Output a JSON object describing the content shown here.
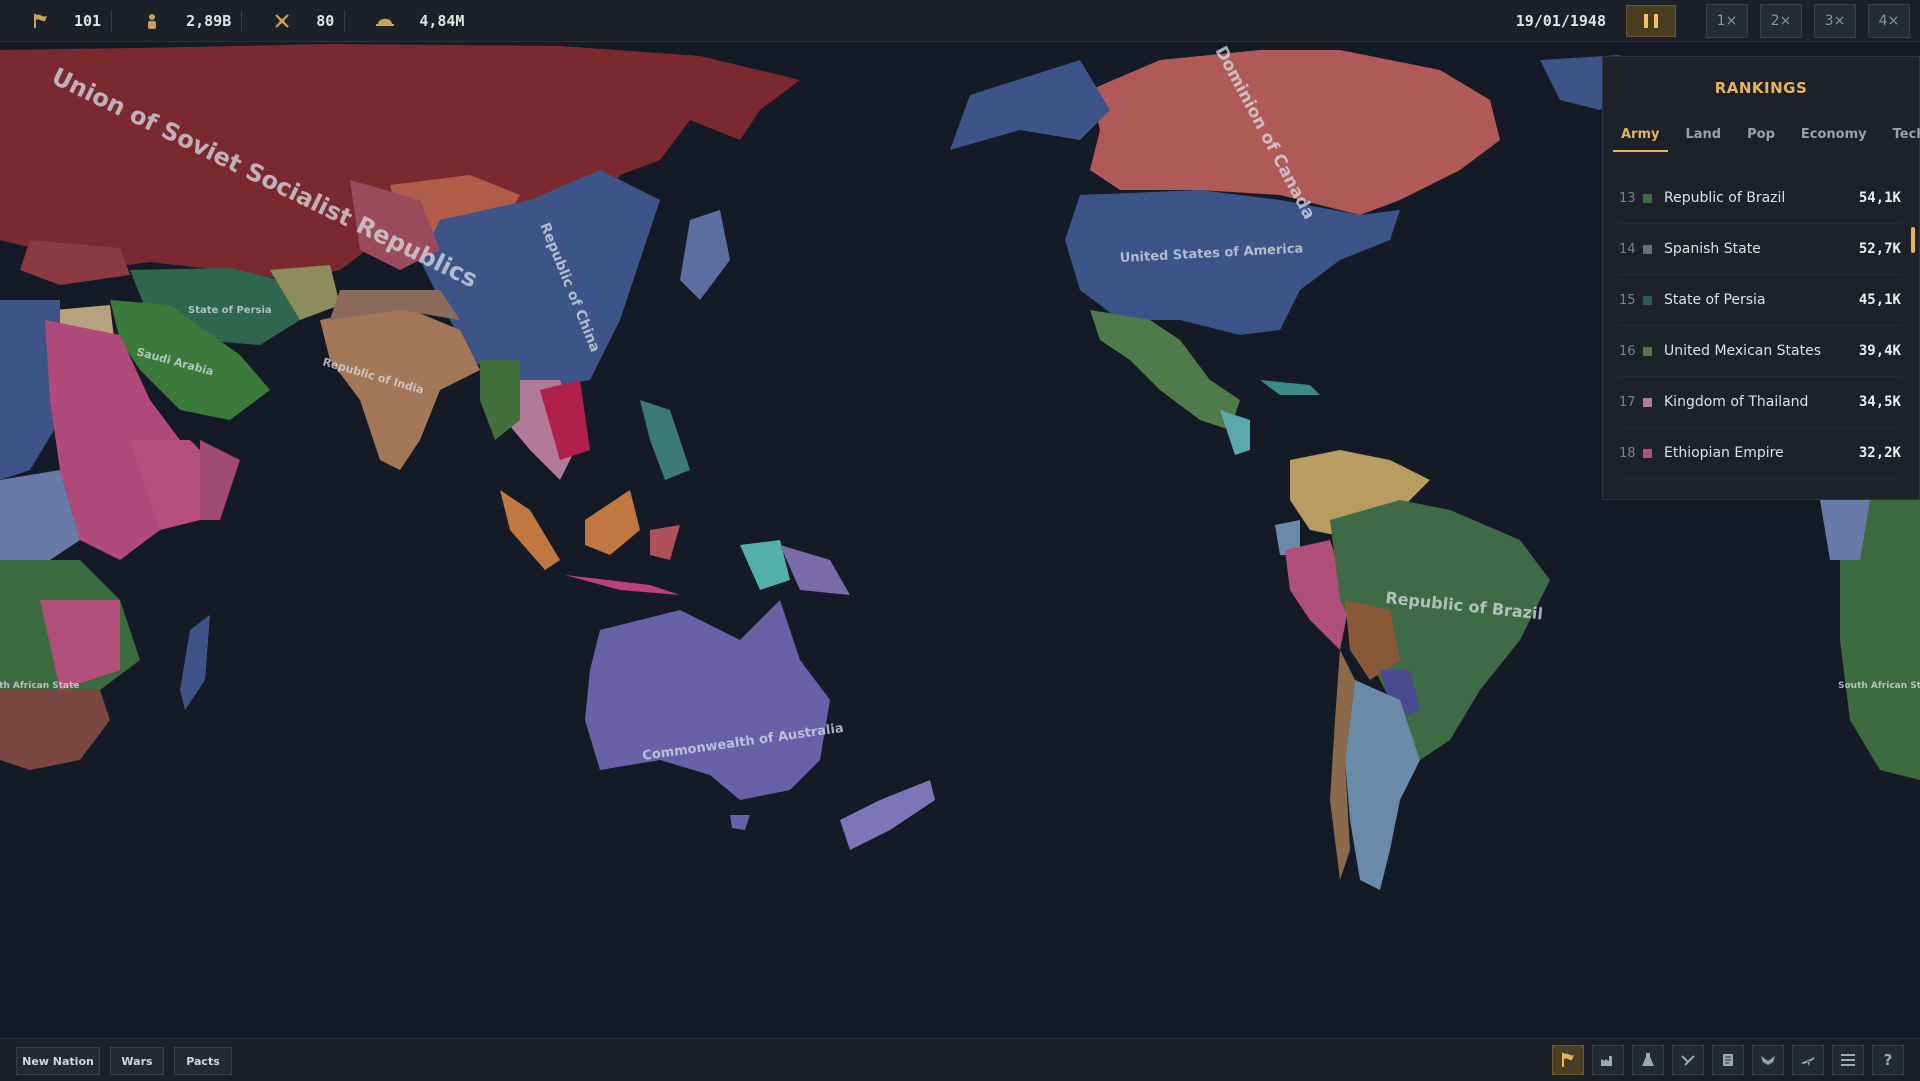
{
  "topbar": {
    "stats": [
      {
        "icon": "flag-icon",
        "value": "101"
      },
      {
        "icon": "population-icon",
        "value": "2,89B"
      },
      {
        "icon": "crossed-swords-icon",
        "value": "80"
      },
      {
        "icon": "soldier-helmet-icon",
        "value": "4,84M"
      }
    ],
    "date": "19/01/1948",
    "speeds": [
      "1×",
      "2×",
      "3×",
      "4×"
    ]
  },
  "rankings": {
    "title": "RANKINGS",
    "tabs": [
      "Army",
      "Land",
      "Pop",
      "Economy",
      "Tech"
    ],
    "active_tab": "Army",
    "rows": [
      {
        "rank": "13",
        "name": "Republic of Brazil",
        "value": "54,1K",
        "color": "#3e6a45"
      },
      {
        "rank": "14",
        "name": "Spanish State",
        "value": "52,7K",
        "color": "#6e6e6e"
      },
      {
        "rank": "15",
        "name": "State of Persia",
        "value": "45,1K",
        "color": "#2f5b48"
      },
      {
        "rank": "16",
        "name": "United Mexican States",
        "value": "39,4K",
        "color": "#4f7a4a"
      },
      {
        "rank": "17",
        "name": "Kingdom of Thailand",
        "value": "34,5K",
        "color": "#b07a98"
      },
      {
        "rank": "18",
        "name": "Ethiopian Empire",
        "value": "32,2K",
        "color": "#b5507c"
      }
    ]
  },
  "map": {
    "labels": {
      "ussr": "Union of Soviet Socialist Republics",
      "canada": "Dominion of Canada",
      "usa": "United States of America",
      "china": "Republic of China",
      "persia": "State of Persia",
      "saudi": "Saudi Arabia",
      "india": "Republic of India",
      "australia": "Commonwealth of Australia",
      "brazil": "Republic of Brazil",
      "south_africa": "South African State"
    }
  },
  "bottombar": {
    "buttons": [
      "New Nation",
      "Wars",
      "Pacts"
    ],
    "icons": [
      "flag-icon",
      "factory-icon",
      "flask-icon",
      "diplomacy-icon",
      "scroll-icon",
      "eagle-icon",
      "plane-icon",
      "menu-icon",
      "help-icon"
    ]
  }
}
